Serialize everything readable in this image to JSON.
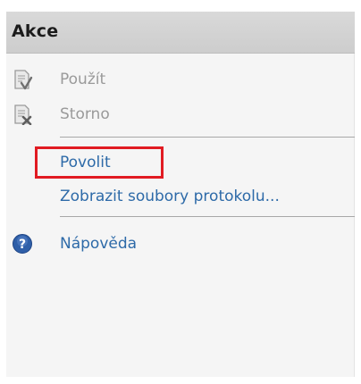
{
  "panel": {
    "title": "Akce",
    "actions_group1": [
      {
        "label": "Použít",
        "icon": "apply-document-icon",
        "enabled": false
      },
      {
        "label": "Storno",
        "icon": "cancel-document-icon",
        "enabled": false
      }
    ],
    "actions_group2": [
      {
        "label": "Povolit",
        "enabled": true,
        "highlighted": true
      },
      {
        "label": "Zobrazit soubory protokolu...",
        "enabled": true
      }
    ],
    "actions_group3": [
      {
        "label": "Nápověda",
        "icon": "help-icon",
        "enabled": true
      }
    ]
  },
  "colors": {
    "header_bg": "#d3d3d3",
    "link_text": "#2d6aa8",
    "disabled_text": "#9a9a9a",
    "highlight_border": "#e11b22",
    "help_icon": "#2f5fa8"
  }
}
